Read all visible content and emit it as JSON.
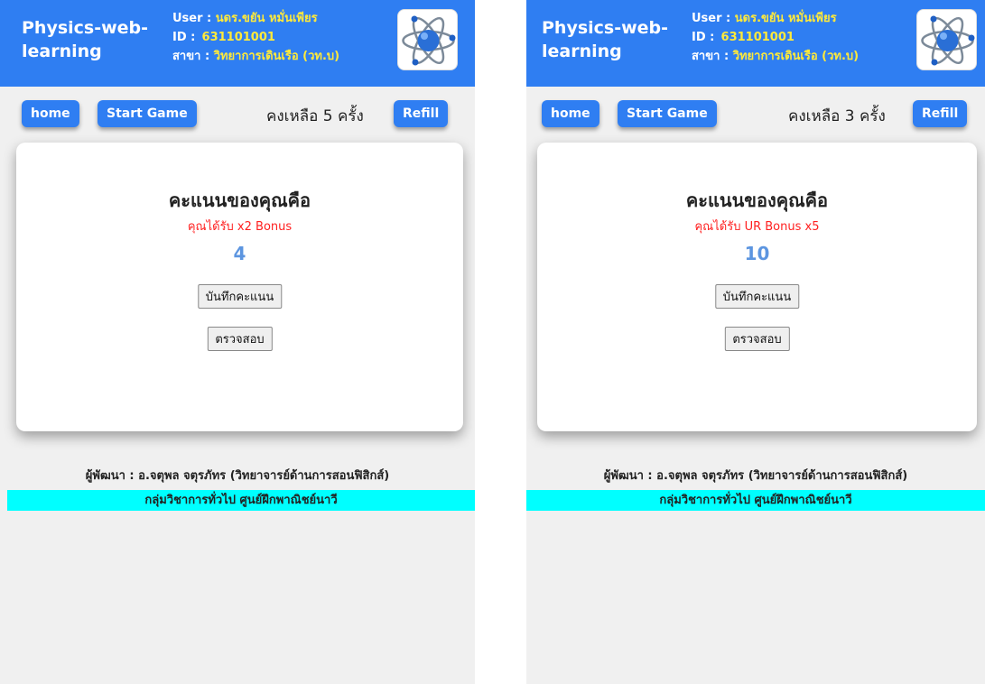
{
  "screens": [
    {
      "brand": "Physics-web-learning",
      "user_label": "User :",
      "user_value": "นดร.ขยัน หมั่นเพียร",
      "id_label": "ID :",
      "id_value": "631101001",
      "branch_label": "สาขา :",
      "branch_value": "วิทยาการเดินเรือ (วท.บ)",
      "logo_icon": "atom-icon",
      "home_label": "home",
      "start_label": "Start Game",
      "remaining_text": "คงเหลือ 5 ครั้ง",
      "refill_label": "Refill",
      "score_title": "คะแนนของคุณคือ",
      "bonus_text": "คุณได้รับ x2 Bonus",
      "score_value": "4",
      "save_label": "บันทึกคะแนน",
      "check_label": "ตรวจสอบ",
      "developer_text": "ผู้พัฒนา : อ.จตุพล จตุรภัทร (วิทยาจารย์ด้านการสอนฟิสิกส์)",
      "org_text": "กลุ่มวิชาการทั่วไป ศูนย์ฝึกพาณิชย์นาวี"
    },
    {
      "brand": "Physics-web-learning",
      "user_label": "User :",
      "user_value": "นดร.ขยัน หมั่นเพียร",
      "id_label": "ID :",
      "id_value": "631101001",
      "branch_label": "สาขา :",
      "branch_value": "วิทยาการเดินเรือ (วท.บ)",
      "logo_icon": "atom-icon",
      "home_label": "home",
      "start_label": "Start Game",
      "remaining_text": "คงเหลือ 3 ครั้ง",
      "refill_label": "Refill",
      "score_title": "คะแนนของคุณคือ",
      "bonus_text": "คุณได้รับ UR Bonus x5",
      "score_value": "10",
      "save_label": "บันทึกคะแนน",
      "check_label": "ตรวจสอบ",
      "developer_text": "ผู้พัฒนา : อ.จตุพล จตุรภัทร (วิทยาจารย์ด้านการสอนฟิสิกส์)",
      "org_text": "กลุ่มวิชาการทั่วไป ศูนย์ฝึกพาณิชย์นาวี"
    }
  ],
  "colors": {
    "header_blue": "#2f7ef2",
    "user_value_yellow": "#ffea3a",
    "bonus_red": "#ff2020",
    "score_blue": "#5c95e0",
    "org_bar_cyan": "#00ffff",
    "page_bg": "#f0f0f0"
  }
}
